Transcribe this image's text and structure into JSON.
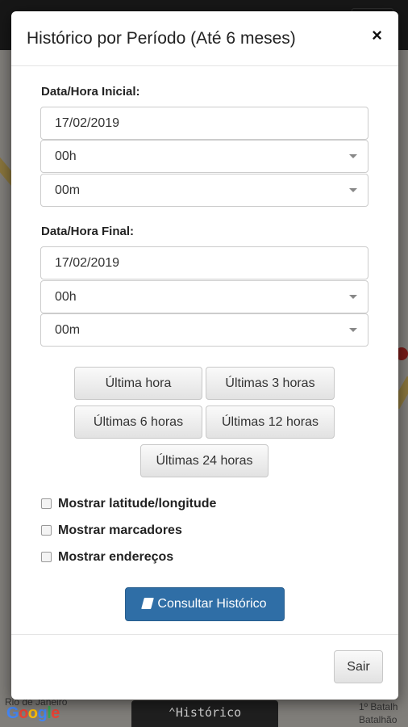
{
  "modal": {
    "title": "Histórico por Período (Até 6 meses)",
    "close_symbol": "×"
  },
  "start": {
    "label": "Data/Hora Inicial:",
    "date_value": "17/02/2019",
    "hour_value": "00h",
    "minute_value": "00m"
  },
  "end": {
    "label": "Data/Hora Final:",
    "date_value": "17/02/2019",
    "hour_value": "00h",
    "minute_value": "00m"
  },
  "quick_ranges": [
    "Última hora",
    "Últimas 3 horas",
    "Últimas 6 horas",
    "Últimas 12 horas",
    "Últimas 24 horas"
  ],
  "options": [
    {
      "label": "Mostrar latitude/longitude",
      "checked": false
    },
    {
      "label": "Mostrar marcadores",
      "checked": false
    },
    {
      "label": "Mostrar endereços",
      "checked": false
    }
  ],
  "submit_label": "Consultar Histórico",
  "footer": {
    "exit_label": "Sair"
  },
  "background": {
    "tab_label": "⌃Histórico",
    "logo_text": "Google",
    "map_labels": [
      "Rio de Janeiro",
      "1º Batalh",
      "Batalhão"
    ]
  },
  "colors": {
    "primary": "#2f6ea6",
    "overlay": "rgba(0,0,0,0.45)"
  },
  "icons": {
    "close": "close-icon",
    "submit": "book-icon",
    "select_caret": "chevron-down-icon"
  }
}
